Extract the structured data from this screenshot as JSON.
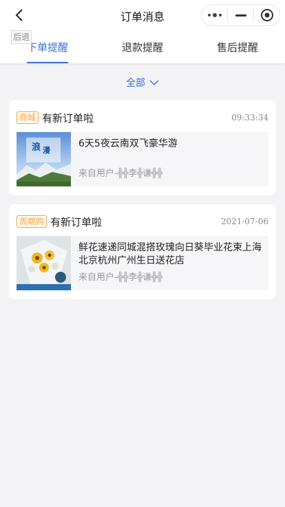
{
  "nav": {
    "title": "订单消息",
    "back_tag": "后退"
  },
  "tabs": [
    {
      "label": "下单提醒",
      "active": true
    },
    {
      "label": "退款提醒",
      "active": false
    },
    {
      "label": "售后提醒",
      "active": false
    }
  ],
  "filter": {
    "label": "全部"
  },
  "orders": [
    {
      "badge": "商城",
      "title": "有新订单啦",
      "time": "09:33:34",
      "product": "6天5夜云南双飞豪华游",
      "from": "来自用户-╬╬李╬谦╬╬"
    },
    {
      "badge": "周期购",
      "title": "有新订单啦",
      "time": "2021-07-06",
      "product": "鲜花速递同城混搭玫瑰向日葵毕业花束上海北京杭州广州生日送花店",
      "from": "来自用户-╬╬李╬谦╬╬"
    }
  ],
  "colors": {
    "accent": "#3a6fd8",
    "badge": "#f0a030",
    "background": "#f3f3f5"
  }
}
